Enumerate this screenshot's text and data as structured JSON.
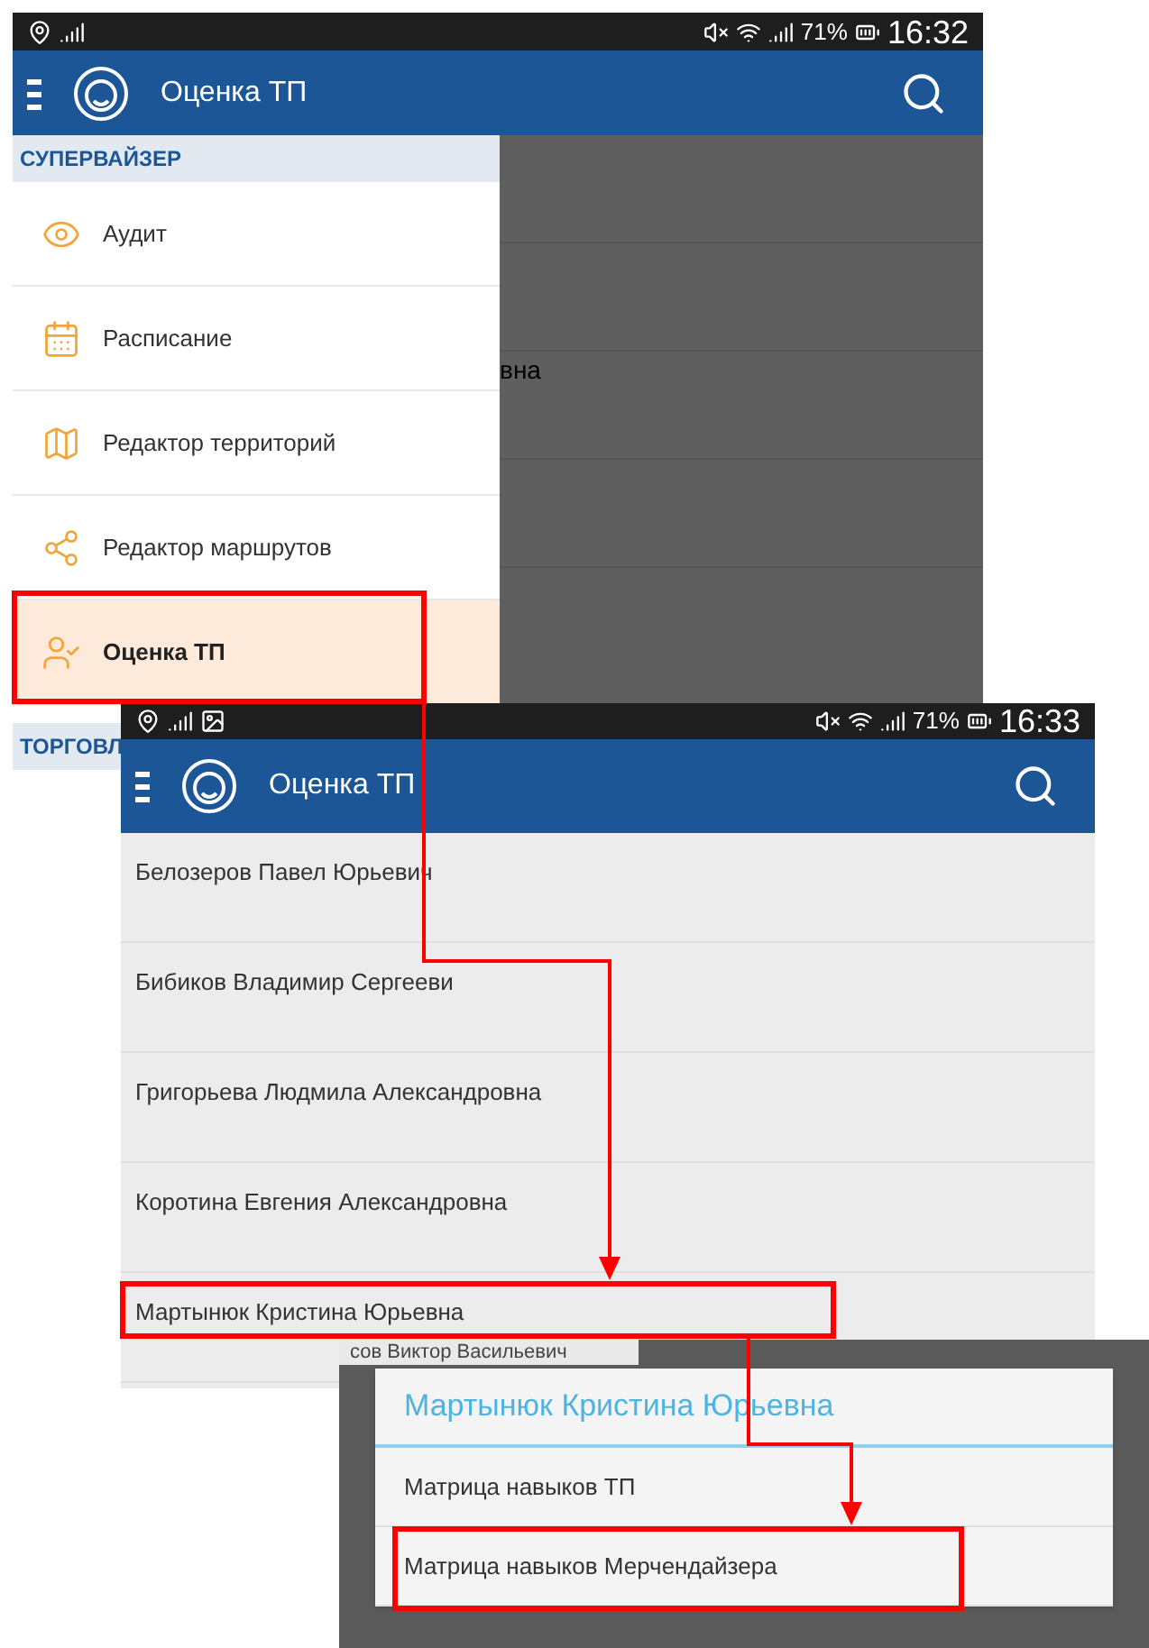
{
  "screen_1": {
    "status_bar": {
      "battery": "71%",
      "time": "16:32"
    },
    "app_bar": {
      "title": "Оценка ТП"
    },
    "drawer": {
      "section": "СУПЕРВАЙЗЕР",
      "items": [
        {
          "label": "Аудит",
          "selected": false
        },
        {
          "label": "Расписание",
          "selected": false
        },
        {
          "label": "Редактор территорий",
          "selected": false
        },
        {
          "label": "Редактор маршрутов",
          "selected": false
        },
        {
          "label": "Оценка ТП",
          "selected": true
        }
      ],
      "next_section": "ТОРГОВЛ"
    },
    "background_text": "вна"
  },
  "screen_2": {
    "status_bar": {
      "battery": "71%",
      "time": "16:33"
    },
    "app_bar": {
      "title": "Оценка ТП"
    },
    "rows": [
      "Белозеров Павел Юрьевич",
      "Бибиков Владимир Сергееви",
      "Григорьева Людмила Александровна",
      "Коротина Евгения Александровна",
      "Мартынюк Кристина Юрьевна"
    ]
  },
  "screen_3": {
    "background_text": "сов Виктор Васильевич",
    "dialog": {
      "title": "Мартынюк Кристина Юрьевна",
      "options": [
        "Матрица навыков ТП",
        "Матрица навыков Мерчендайзера"
      ]
    }
  }
}
